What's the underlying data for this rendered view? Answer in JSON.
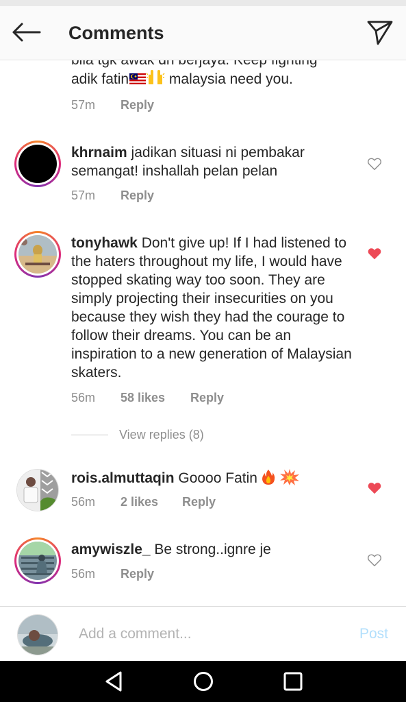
{
  "header": {
    "title": "Comments"
  },
  "comments": [
    {
      "partial_line1": "bila tgk awak dh berjaya. Keep fighting",
      "text_before_emoji": "adik fatin",
      "text_after_emoji": " malaysia need you.",
      "time": "57m",
      "reply": "Reply"
    },
    {
      "username": "khrnaim",
      "text": " jadikan situasi ni pembakar semangat! inshallah pelan pelan",
      "time": "57m",
      "reply": "Reply",
      "liked": false
    },
    {
      "username": "tonyhawk",
      "text": " Don't give up! If I had listened to the haters throughout my life, I would have stopped skating way too soon. They are simply projecting their insecurities on you because they wish they had the courage to follow their dreams. You can be an inspiration to a new generation of Malaysian skaters.",
      "time": "56m",
      "likes": "58 likes",
      "reply": "Reply",
      "liked": true,
      "view_replies": "View replies (8)"
    },
    {
      "username": "rois.almuttaqin",
      "text": " Goooo Fatin ",
      "time": "56m",
      "likes": "2 likes",
      "reply": "Reply",
      "liked": true
    },
    {
      "username": "amywiszle_",
      "text": " Be strong..ignre je",
      "time": "56m",
      "reply": "Reply",
      "liked": false
    }
  ],
  "composer": {
    "placeholder": "Add a comment...",
    "post_label": "Post"
  },
  "colors": {
    "heart_active": "#ed4956",
    "post_disabled": "#b2dffc",
    "meta_gray": "#8e8e8e"
  }
}
